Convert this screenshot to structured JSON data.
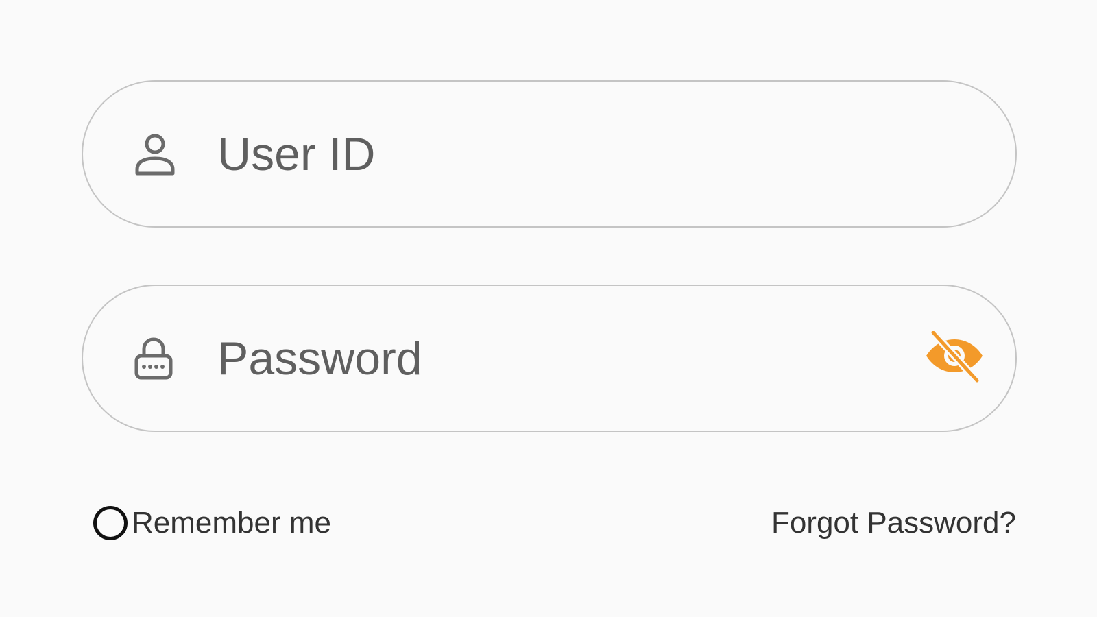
{
  "form": {
    "user_id": {
      "placeholder": "User ID",
      "value": "",
      "icon": "user-icon"
    },
    "password": {
      "placeholder": "Password",
      "value": "",
      "icon": "lock-icon",
      "toggle_icon": "eye-off-icon"
    },
    "remember_me": {
      "label": "Remember me",
      "checked": false
    },
    "forgot_password_label": "Forgot Password?"
  },
  "colors": {
    "background": "#fafafa",
    "field_border": "#c4c4c4",
    "icon_gray": "#6b6b6b",
    "accent": "#f39a2a",
    "text": "#333333"
  }
}
